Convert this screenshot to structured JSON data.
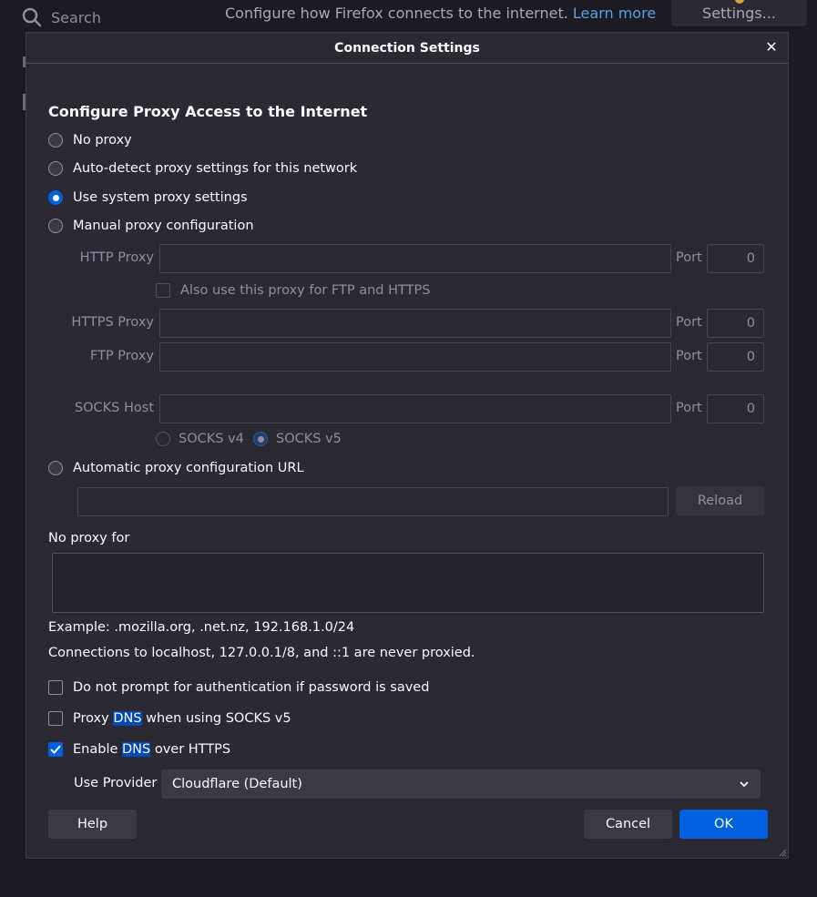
{
  "background": {
    "search_placeholder": "Search",
    "description": "Configure how Firefox connects to the internet.",
    "learn_more": "Learn more",
    "settings_button": "Settings..."
  },
  "dialog": {
    "title": "Connection Settings",
    "heading": "Configure Proxy Access to the Internet",
    "proxy_options": {
      "no_proxy": "No proxy",
      "auto_detect": "Auto-detect proxy settings for this network",
      "system": "Use system proxy settings",
      "manual": "Manual proxy configuration",
      "selected": "system"
    },
    "http_proxy_label": "HTTP Proxy",
    "http_port_label": "Port",
    "http_port_value": "0",
    "also_use_label": "Also use this proxy for FTP and HTTPS",
    "https_proxy_label": "HTTPS Proxy",
    "https_port_label": "Port",
    "https_port_value": "0",
    "ftp_proxy_label": "FTP Proxy",
    "ftp_port_label": "Port",
    "ftp_port_value": "0",
    "socks_host_label": "SOCKS Host",
    "socks_port_label": "Port",
    "socks_port_value": "0",
    "socks_v4_label": "SOCKS v4",
    "socks_v5_label": "SOCKS v5",
    "socks_selected": "v5",
    "auto_config_label": "Automatic proxy configuration URL",
    "auto_config_url": "",
    "reload_button": "Reload",
    "no_proxy_for_label": "No proxy for",
    "no_proxy_for_value": "",
    "example_text": "Example: .mozilla.org, .net.nz, 192.168.1.0/24",
    "localhost_text": "Connections to localhost, 127.0.0.1/8, and ::1 are never proxied.",
    "checkboxes": {
      "no_prompt_auth": {
        "label": "Do not prompt for authentication if password is saved",
        "checked": false
      },
      "proxy_dns": {
        "label_pre": "Proxy ",
        "label_hl": "DNS",
        "label_post": " when using SOCKS v5",
        "checked": false
      },
      "enable_doh": {
        "label_pre": "Enable ",
        "label_hl": "DNS",
        "label_post": " over HTTPS",
        "checked": true
      }
    },
    "use_provider_label": "Use Provider",
    "provider_selected": "Cloudflare (Default)",
    "help_button": "Help",
    "cancel_button": "Cancel",
    "ok_button": "OK"
  },
  "colors": {
    "accent": "#0061e0",
    "dialog_bg": "#2b2a33",
    "page_bg": "#1c1b22",
    "link": "#55a0e8"
  }
}
